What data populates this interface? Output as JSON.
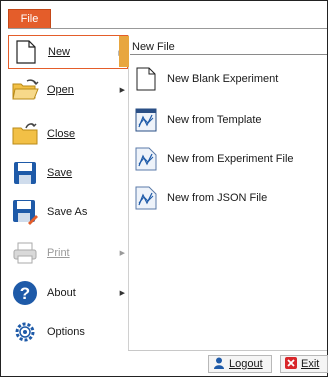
{
  "file_tab": {
    "label": "File"
  },
  "menu": {
    "items": [
      {
        "label": "New",
        "selected": true,
        "has_submenu": true,
        "disabled": false
      },
      {
        "label": "Open",
        "selected": false,
        "has_submenu": true,
        "disabled": false
      },
      {
        "label": "Close",
        "selected": false,
        "has_submenu": false,
        "disabled": false
      },
      {
        "label": "Save",
        "selected": false,
        "has_submenu": false,
        "disabled": false
      },
      {
        "label": "Save As",
        "selected": false,
        "has_submenu": false,
        "disabled": false
      },
      {
        "label": "Print",
        "selected": false,
        "has_submenu": true,
        "disabled": true
      },
      {
        "label": "About",
        "selected": false,
        "has_submenu": true,
        "disabled": false
      },
      {
        "label": "Options",
        "selected": false,
        "has_submenu": false,
        "disabled": false
      }
    ]
  },
  "submenu": {
    "title": "New File",
    "items": [
      {
        "label": "New Blank Experiment",
        "icon": "blank-document-icon"
      },
      {
        "label": "New from Template",
        "icon": "template-icon"
      },
      {
        "label": "New from Experiment File",
        "icon": "experiment-file-icon"
      },
      {
        "label": "New from JSON File",
        "icon": "json-file-icon"
      }
    ]
  },
  "footer": {
    "logout_label": "Logout",
    "exit_label": "Exit"
  },
  "colors": {
    "accent": "#e45d2a",
    "selected_arrow": "#e8a63f"
  }
}
